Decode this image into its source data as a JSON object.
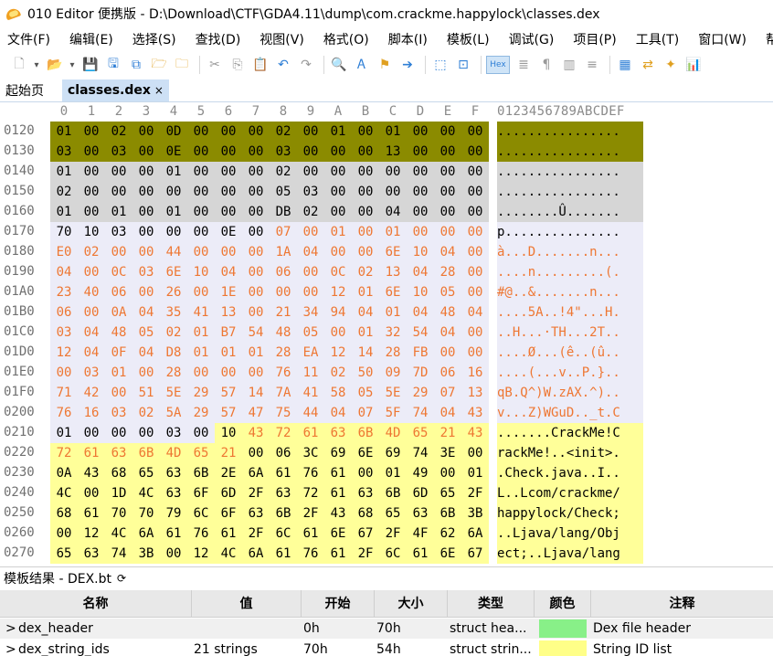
{
  "window": {
    "title": "010 Editor 便携版 - D:\\Download\\CTF\\GDA4.11\\dump\\com.crackme.happylock\\classes.dex"
  },
  "menu": [
    "文件(F)",
    "编辑(E)",
    "选择(S)",
    "查找(D)",
    "视图(V)",
    "格式(O)",
    "脚本(I)",
    "模板(L)",
    "调试(G)",
    "项目(P)",
    "工具(T)",
    "窗口(W)",
    "帮助(H)"
  ],
  "toolbar": {
    "hex_label": "Hex"
  },
  "tabs": {
    "home": "起始页",
    "file": "classes.dex",
    "close_glyph": "×"
  },
  "hex": {
    "header_cols": [
      "0",
      "1",
      "2",
      "3",
      "4",
      "5",
      "6",
      "7",
      "8",
      "9",
      "A",
      "B",
      "C",
      "D",
      "E",
      "F"
    ],
    "ascii_header": "0123456789ABCDEF",
    "colors": {
      "olive": "#8b8b00",
      "grey": "#d6d6d6",
      "lavender": "#ececf8",
      "yellow": "#ffff99",
      "orange_text": "#ee7733"
    },
    "rows": [
      {
        "addr": "0120",
        "bytes": [
          "01",
          "00",
          "02",
          "00",
          "0D",
          "00",
          "00",
          "00",
          "02",
          "00",
          "01",
          "00",
          "01",
          "00",
          "00",
          "00"
        ],
        "ascii": "................"
      },
      {
        "addr": "0130",
        "bytes": [
          "03",
          "00",
          "03",
          "00",
          "0E",
          "00",
          "00",
          "00",
          "03",
          "00",
          "00",
          "00",
          "13",
          "00",
          "00",
          "00"
        ],
        "ascii": "................"
      },
      {
        "addr": "0140",
        "bytes": [
          "01",
          "00",
          "00",
          "00",
          "01",
          "00",
          "00",
          "00",
          "02",
          "00",
          "00",
          "00",
          "00",
          "00",
          "00",
          "00"
        ],
        "ascii": "................"
      },
      {
        "addr": "0150",
        "bytes": [
          "02",
          "00",
          "00",
          "00",
          "00",
          "00",
          "00",
          "00",
          "05",
          "03",
          "00",
          "00",
          "00",
          "00",
          "00",
          "00"
        ],
        "ascii": "................"
      },
      {
        "addr": "0160",
        "bytes": [
          "01",
          "00",
          "01",
          "00",
          "01",
          "00",
          "00",
          "00",
          "DB",
          "02",
          "00",
          "00",
          "04",
          "00",
          "00",
          "00"
        ],
        "ascii": "........Û......."
      },
      {
        "addr": "0170",
        "bytes": [
          "70",
          "10",
          "03",
          "00",
          "00",
          "00",
          "0E",
          "00",
          "07",
          "00",
          "01",
          "00",
          "01",
          "00",
          "00",
          "00"
        ],
        "ascii": "p..............."
      },
      {
        "addr": "0180",
        "bytes": [
          "E0",
          "02",
          "00",
          "00",
          "44",
          "00",
          "00",
          "00",
          "1A",
          "04",
          "00",
          "00",
          "6E",
          "10",
          "04",
          "00"
        ],
        "ascii": "à...D.......n..."
      },
      {
        "addr": "0190",
        "bytes": [
          "04",
          "00",
          "0C",
          "03",
          "6E",
          "10",
          "04",
          "00",
          "06",
          "00",
          "0C",
          "02",
          "13",
          "04",
          "28",
          "00"
        ],
        "ascii": "....n.........(."
      },
      {
        "addr": "01A0",
        "bytes": [
          "23",
          "40",
          "06",
          "00",
          "26",
          "00",
          "1E",
          "00",
          "00",
          "00",
          "12",
          "01",
          "6E",
          "10",
          "05",
          "00"
        ],
        "ascii": "#@..&.......n..."
      },
      {
        "addr": "01B0",
        "bytes": [
          "06",
          "00",
          "0A",
          "04",
          "35",
          "41",
          "13",
          "00",
          "21",
          "34",
          "94",
          "04",
          "01",
          "04",
          "48",
          "04"
        ],
        "ascii": "....5A..!4\"...H."
      },
      {
        "addr": "01C0",
        "bytes": [
          "03",
          "04",
          "48",
          "05",
          "02",
          "01",
          "B7",
          "54",
          "48",
          "05",
          "00",
          "01",
          "32",
          "54",
          "04",
          "00"
        ],
        "ascii": "..H...·TH...2T.."
      },
      {
        "addr": "01D0",
        "bytes": [
          "12",
          "04",
          "0F",
          "04",
          "D8",
          "01",
          "01",
          "01",
          "28",
          "EA",
          "12",
          "14",
          "28",
          "FB",
          "00",
          "00"
        ],
        "ascii": "....Ø...(ê..(û.."
      },
      {
        "addr": "01E0",
        "bytes": [
          "00",
          "03",
          "01",
          "00",
          "28",
          "00",
          "00",
          "00",
          "76",
          "11",
          "02",
          "50",
          "09",
          "7D",
          "06",
          "16"
        ],
        "ascii": "....(...v..P.}.."
      },
      {
        "addr": "01F0",
        "bytes": [
          "71",
          "42",
          "00",
          "51",
          "5E",
          "29",
          "57",
          "14",
          "7A",
          "41",
          "58",
          "05",
          "5E",
          "29",
          "07",
          "13"
        ],
        "ascii": "qB.Q^)W.zAX.^).."
      },
      {
        "addr": "0200",
        "bytes": [
          "76",
          "16",
          "03",
          "02",
          "5A",
          "29",
          "57",
          "47",
          "75",
          "44",
          "04",
          "07",
          "5F",
          "74",
          "04",
          "43"
        ],
        "ascii": "v...Z)WGuD.._t.C"
      },
      {
        "addr": "0210",
        "bytes": [
          "01",
          "00",
          "00",
          "00",
          "03",
          "00",
          "10",
          "43",
          "72",
          "61",
          "63",
          "6B",
          "4D",
          "65",
          "21",
          "43"
        ],
        "ascii": ".......CrackMe!C"
      },
      {
        "addr": "0220",
        "bytes": [
          "72",
          "61",
          "63",
          "6B",
          "4D",
          "65",
          "21",
          "00",
          "06",
          "3C",
          "69",
          "6E",
          "69",
          "74",
          "3E",
          "00"
        ],
        "ascii": "rackMe!..<init>."
      },
      {
        "addr": "0230",
        "bytes": [
          "0A",
          "43",
          "68",
          "65",
          "63",
          "6B",
          "2E",
          "6A",
          "61",
          "76",
          "61",
          "00",
          "01",
          "49",
          "00",
          "01"
        ],
        "ascii": ".Check.java..I.."
      },
      {
        "addr": "0240",
        "bytes": [
          "4C",
          "00",
          "1D",
          "4C",
          "63",
          "6F",
          "6D",
          "2F",
          "63",
          "72",
          "61",
          "63",
          "6B",
          "6D",
          "65",
          "2F"
        ],
        "ascii": "L..Lcom/crackme/"
      },
      {
        "addr": "0250",
        "bytes": [
          "68",
          "61",
          "70",
          "70",
          "79",
          "6C",
          "6F",
          "63",
          "6B",
          "2F",
          "43",
          "68",
          "65",
          "63",
          "6B",
          "3B"
        ],
        "ascii": "happylock/Check;"
      },
      {
        "addr": "0260",
        "bytes": [
          "00",
          "12",
          "4C",
          "6A",
          "61",
          "76",
          "61",
          "2F",
          "6C",
          "61",
          "6E",
          "67",
          "2F",
          "4F",
          "62",
          "6A"
        ],
        "ascii": "..Ljava/lang/Obj"
      },
      {
        "addr": "0270",
        "bytes": [
          "65",
          "63",
          "74",
          "3B",
          "00",
          "12",
          "4C",
          "6A",
          "61",
          "76",
          "61",
          "2F",
          "6C",
          "61",
          "6E",
          "67"
        ],
        "ascii": "ect;..Ljava/lang"
      }
    ]
  },
  "template_panel": {
    "title": "模板结果 - DEX.bt",
    "refresh_glyph": "⟳",
    "columns": [
      "名称",
      "值",
      "开始",
      "大小",
      "类型",
      "颜色",
      "注释"
    ],
    "rows": [
      {
        "expander": ">",
        "name": "dex_header",
        "value": "",
        "start": "0h",
        "size": "70h",
        "type": "struct hea...",
        "color": "#88f088",
        "comment": "Dex file header"
      },
      {
        "expander": ">",
        "name": "dex_string_ids",
        "value": "21 strings",
        "start": "70h",
        "size": "54h",
        "type": "struct strin...",
        "color": "#ffff88",
        "comment": "String ID list"
      }
    ]
  }
}
